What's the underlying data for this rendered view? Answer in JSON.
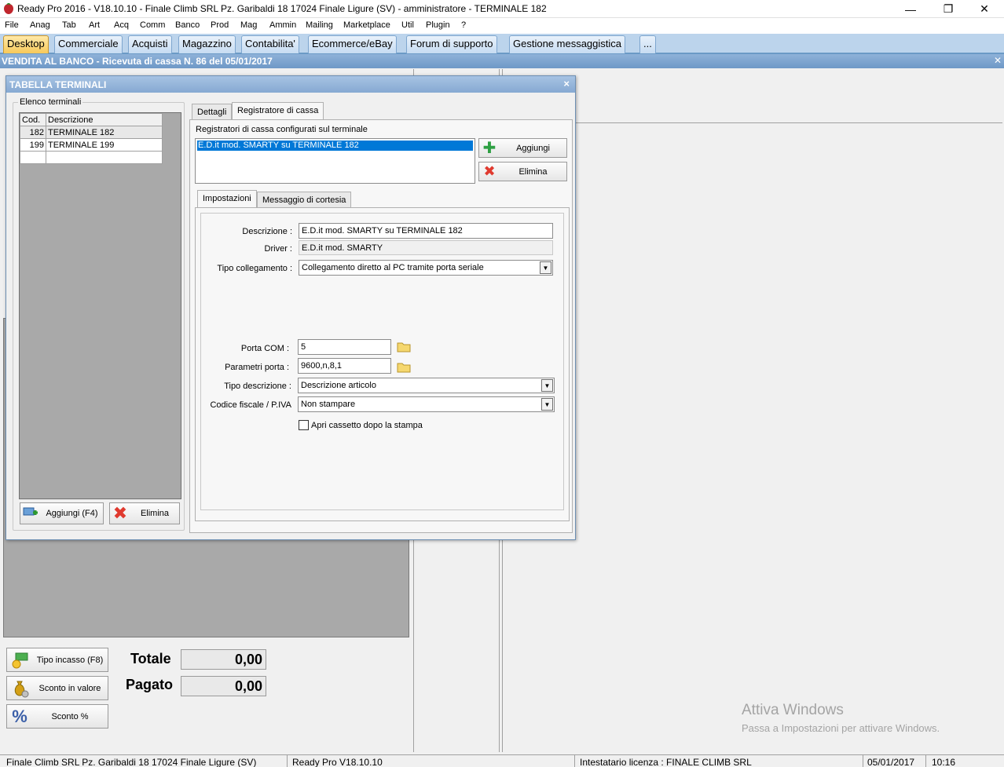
{
  "window": {
    "title": "Ready Pro 2016 - V18.10.10 - Finale Climb SRL Pz. Garibaldi 18 17024 Finale Ligure (SV)  - amministratore - TERMINALE 182",
    "minimize_glyph": "—",
    "maximize_glyph": "❐",
    "close_glyph": "✕"
  },
  "menu": [
    "File",
    "Anag",
    "Tab",
    "Art",
    "Acq",
    "Comm",
    "Banco",
    "Prod",
    "Mag",
    "Ammin",
    "Mailing",
    "Marketplace",
    "Util",
    "Plugin",
    "?"
  ],
  "main_tabs": [
    "Desktop",
    "Commerciale",
    "Acquisti",
    "Magazzino",
    "Contabilita'",
    "Ecommerce/eBay",
    "Forum di supporto",
    "Gestione messaggistica",
    "..."
  ],
  "active_main_tab": "Desktop",
  "document": {
    "title": "VENDITA AL BANCO - Ricevuta di cassa N. 86 del 05/01/2017",
    "close_glyph": "✕"
  },
  "side_buttons": {
    "tipo_incasso": "Tipo incasso (F8)",
    "sconto_valore": "Sconto in valore",
    "sconto_percent": "Sconto %"
  },
  "totals": {
    "totale_label": "Totale",
    "totale_value": "0,00",
    "pagato_label": "Pagato",
    "pagato_value": "0,00"
  },
  "watermark": {
    "line1": "Attiva Windows",
    "line2": "Passa a Impostazioni per attivare Windows."
  },
  "statusbar": {
    "company": "Finale Climb SRL Pz. Garibaldi 18 17024 Finale Ligure (SV)",
    "version": "Ready Pro V18.10.10",
    "license": "Intestatario licenza : FINALE CLIMB SRL",
    "date": "05/01/2017",
    "time": "10:16"
  },
  "dialog": {
    "title": "TABELLA TERMINALI",
    "close_glyph": "×",
    "terminal_list": {
      "group_label": "Elenco terminali",
      "columns": [
        "Cod.",
        "Descrizione"
      ],
      "rows": [
        {
          "cod": "182",
          "descrizione": "TERMINALE 182"
        },
        {
          "cod": "199",
          "descrizione": "TERMINALE 199"
        }
      ],
      "add_button": "Aggiungi (F4)",
      "delete_button": "Elimina"
    },
    "tabs": [
      "Dettagli",
      "Registratore di cassa"
    ],
    "active_tab": "Registratore di cassa",
    "registers": {
      "caption": "Registratori di cassa configurati sul terminale",
      "items": [
        "E.D.it mod. SMARTY su TERMINALE 182"
      ],
      "add_button": "Aggiungi",
      "delete_button": "Elimina"
    },
    "subtabs": [
      "Impostazioni",
      "Messaggio di cortesia"
    ],
    "active_subtab": "Impostazioni",
    "form": {
      "descrizione_label": "Descrizione :",
      "descrizione_value": "E.D.it mod. SMARTY su TERMINALE 182",
      "driver_label": "Driver :",
      "driver_value": "E.D.it mod. SMARTY",
      "tipo_collegamento_label": "Tipo collegamento :",
      "tipo_collegamento_value": "Collegamento diretto al PC tramite porta seriale",
      "porta_com_label": "Porta COM :",
      "porta_com_value": "5",
      "parametri_porta_label": "Parametri porta :",
      "parametri_porta_value": "9600,n,8,1",
      "tipo_descrizione_label": "Tipo descrizione :",
      "tipo_descrizione_value": "Descrizione articolo",
      "codice_fiscale_label": "Codice fiscale / P.IVA",
      "codice_fiscale_value": "Non stampare",
      "apri_cassetto_label": "Apri cassetto dopo la stampa",
      "apri_cassetto_checked": false
    }
  },
  "colors": {
    "accent_blue": "#0078d7",
    "tab_strip": "#bcd4ec",
    "active_tab": "#f7c95a"
  }
}
